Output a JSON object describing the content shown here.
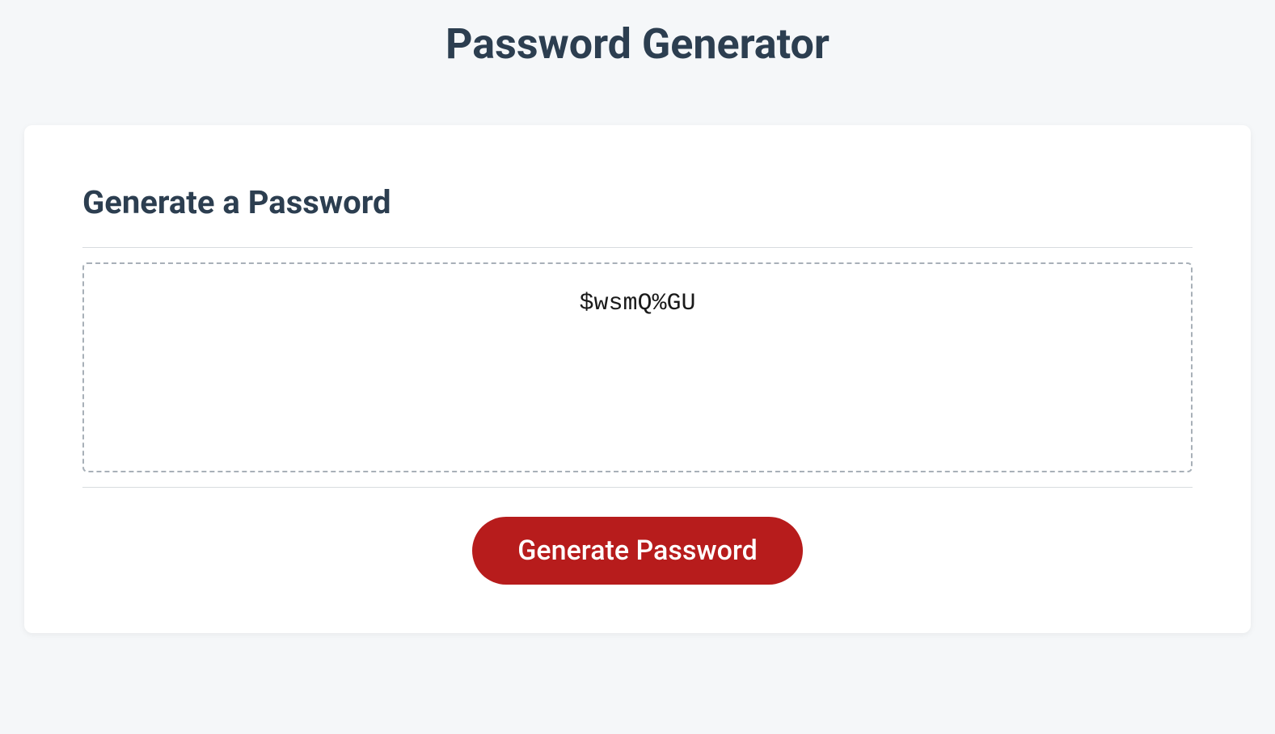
{
  "header": {
    "title": "Password Generator"
  },
  "card": {
    "heading": "Generate a Password",
    "password_value": "$wsmQ%GU",
    "generate_button_label": "Generate Password"
  }
}
